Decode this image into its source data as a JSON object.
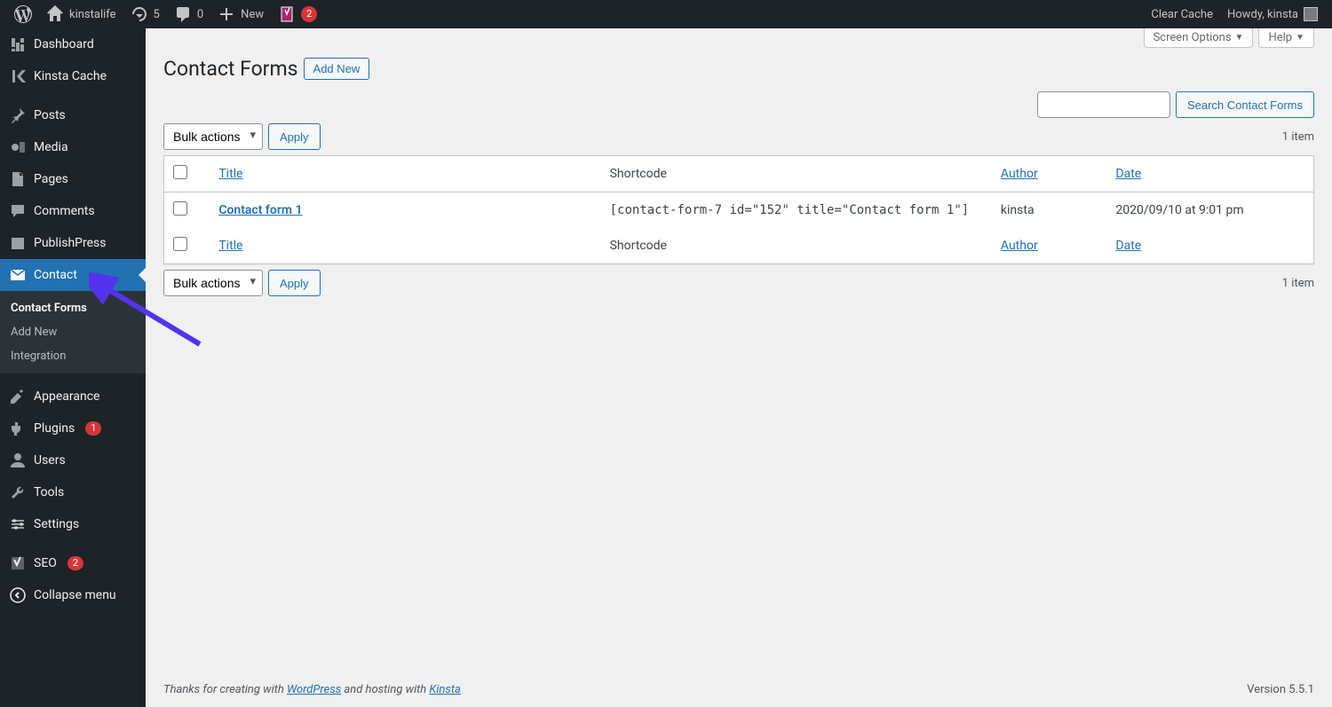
{
  "adminbar": {
    "site": "kinstalife",
    "updates": "5",
    "comments": "0",
    "new": "New",
    "yoast_badge": "2",
    "clear_cache": "Clear Cache",
    "howdy": "Howdy, kinsta"
  },
  "sidebar": {
    "items": [
      {
        "label": "Dashboard"
      },
      {
        "label": "Kinsta Cache"
      },
      {
        "label": "Posts"
      },
      {
        "label": "Media"
      },
      {
        "label": "Pages"
      },
      {
        "label": "Comments"
      },
      {
        "label": "PublishPress"
      },
      {
        "label": "Contact"
      },
      {
        "label": "Appearance"
      },
      {
        "label": "Plugins",
        "badge": "1"
      },
      {
        "label": "Users"
      },
      {
        "label": "Tools"
      },
      {
        "label": "Settings"
      },
      {
        "label": "SEO",
        "badge": "2"
      },
      {
        "label": "Collapse menu"
      }
    ],
    "submenu": {
      "contact_forms": "Contact Forms",
      "add_new": "Add New",
      "integration": "Integration"
    }
  },
  "screen": {
    "options": "Screen Options",
    "help": "Help"
  },
  "page": {
    "title": "Contact Forms",
    "add_new": "Add New",
    "search_button": "Search Contact Forms",
    "bulk": "Bulk actions",
    "apply": "Apply",
    "count": "1 item"
  },
  "table": {
    "cols": {
      "title": "Title",
      "shortcode": "Shortcode",
      "author": "Author",
      "date": "Date"
    },
    "rows": [
      {
        "title": "Contact form 1",
        "shortcode": "[contact-form-7 id=\"152\" title=\"Contact form 1\"]",
        "author": "kinsta",
        "date": "2020/09/10 at 9:01 pm"
      }
    ]
  },
  "footer": {
    "thanks_1": "Thanks for creating with ",
    "wp": "WordPress",
    "thanks_2": " and hosting with ",
    "kinsta": "Kinsta",
    "version": "Version 5.5.1"
  }
}
